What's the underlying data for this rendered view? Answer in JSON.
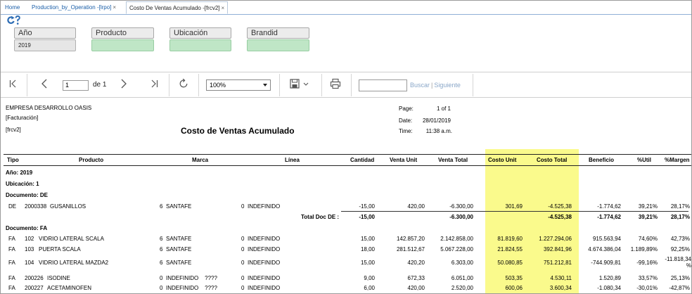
{
  "tabs": [
    {
      "label": "Home",
      "closable": false,
      "active": false
    },
    {
      "label": "Production_by_Operation -[lrpo]",
      "closable": true,
      "active": false
    },
    {
      "label": "Costo De Ventas Acumulado -[frcv2]",
      "closable": true,
      "active": true
    }
  ],
  "close_glyph": "×",
  "params": [
    {
      "label": "Año",
      "value": "2019"
    },
    {
      "label": "Producto",
      "value": ""
    },
    {
      "label": "Ubicación",
      "value": ""
    },
    {
      "label": "Brandid",
      "value": ""
    }
  ],
  "toolbar": {
    "page_value": "1",
    "page_of": "de 1",
    "zoom": "100%",
    "find_label": "Buscar",
    "next_label": "Siguiente"
  },
  "report": {
    "company": "EMPRESA DESARROLLO OASIS",
    "subtitle1": "[Facturación]",
    "subtitle2": "[frcv2]",
    "title": "Costo de Ventas Acumulado",
    "meta": {
      "page_label": "Page:",
      "page_value": "1 of 1",
      "date_label": "Date:",
      "date_value": "28/01/2019",
      "time_label": "Time:",
      "time_value": "11:38 a.m."
    },
    "headers": {
      "tipo": "Tipo",
      "producto": "Producto",
      "marca": "Marca",
      "linea": "Línea",
      "cantidad": "Cantidad",
      "venta_unit": "Venta Unit",
      "venta_total": "Venta Total",
      "costo_unit": "Costo Unit",
      "costo_total": "Costo Total",
      "beneficio": "Beneficio",
      "util": "%Util",
      "margen": "%Margen"
    },
    "year_group": "Año: 2019",
    "location_group": "Ubicación: 1",
    "doc_de": "Documento: DE",
    "doc_fa": "Documento: FA",
    "rows_de": [
      {
        "tipo": "DE",
        "code": "2000338",
        "name": "GUSANILLOS",
        "marca_id": "6",
        "marca": "SANTAFE",
        "linea_id": "0",
        "linea": "INDEFINIDO",
        "cantidad": "-15,00",
        "venta_unit": "420,00",
        "venta_total": "-6.300,00",
        "costo_unit": "301,69",
        "costo_total": "-4.525,38",
        "beneficio": "-1.774,62",
        "util": "39,21%",
        "margen": "28,17%"
      }
    ],
    "total_de": {
      "label": "Total Doc DE :",
      "cantidad": "-15,00",
      "venta_total": "-6.300,00",
      "costo_total": "-4.525,38",
      "beneficio": "-1.774,62",
      "util": "39,21%",
      "margen": "28,17%"
    },
    "rows_fa": [
      {
        "tipo": "FA",
        "code": "102",
        "name": "VIDRIO LATERAL SCALA",
        "marca_id": "6",
        "marca": "SANTAFE",
        "linea_id": "0",
        "linea": "INDEFINIDO",
        "cantidad": "15,00",
        "venta_unit": "142.857,20",
        "venta_total": "2.142.858,00",
        "costo_unit": "81.819,60",
        "costo_total": "1.227.294,06",
        "beneficio": "915.563,94",
        "util": "74,60%",
        "margen": "42,73%"
      },
      {
        "tipo": "FA",
        "code": "103",
        "name": "PUERTA SCALA",
        "marca_id": "6",
        "marca": "SANTAFE",
        "linea_id": "0",
        "linea": "INDEFINIDO",
        "cantidad": "18,00",
        "venta_unit": "281.512,67",
        "venta_total": "5.067.228,00",
        "costo_unit": "21.824,55",
        "costo_total": "392.841,96",
        "beneficio": "4.674.386,04",
        "util": "1.189,89%",
        "margen": "92,25%"
      },
      {
        "tipo": "FA",
        "code": "104",
        "name": "VIDRIO LATERAL MAZDA2",
        "marca_id": "6",
        "marca": "SANTAFE",
        "linea_id": "0",
        "linea": "INDEFINIDO",
        "cantidad": "15,00",
        "venta_unit": "420,20",
        "venta_total": "6.303,00",
        "costo_unit": "50.080,85",
        "costo_total": "751.212,81",
        "beneficio": "-744.909,81",
        "util": "-99,16%",
        "margen": "-11.818,34 %"
      },
      {
        "tipo": "FA",
        "code": "200226",
        "name": "ISODINE",
        "marca_id": "0",
        "marca": "INDEFINIDO    ????",
        "linea_id": "0",
        "linea": "INDEFINIDO",
        "cantidad": "9,00",
        "venta_unit": "672,33",
        "venta_total": "6.051,00",
        "costo_unit": "503,35",
        "costo_total": "4.530,11",
        "beneficio": "1.520,89",
        "util": "33,57%",
        "margen": "25,13%"
      },
      {
        "tipo": "FA",
        "code": "200227",
        "name": "ACETAMINOFEN",
        "marca_id": "0",
        "marca": "INDEFINIDO    ????",
        "linea_id": "0",
        "linea": "INDEFINIDO",
        "cantidad": "6,00",
        "venta_unit": "420,00",
        "venta_total": "2.520,00",
        "costo_unit": "600,06",
        "costo_total": "3.600,34",
        "beneficio": "-1.080,34",
        "util": "-30,01%",
        "margen": "-42,87%"
      }
    ]
  },
  "icons": {
    "refresh": "refresh-help-icon",
    "first": "first-page-icon",
    "prev": "prev-page-icon",
    "next": "next-page-icon",
    "last": "last-page-icon",
    "reload": "reload-icon",
    "save": "save-icon",
    "print": "print-icon"
  },
  "colors": {
    "tab_link": "#1a5ea8",
    "param_green": "#bfe6c6",
    "cost_highlight": "#fafa8c",
    "search_link": "#2c6fb3"
  }
}
